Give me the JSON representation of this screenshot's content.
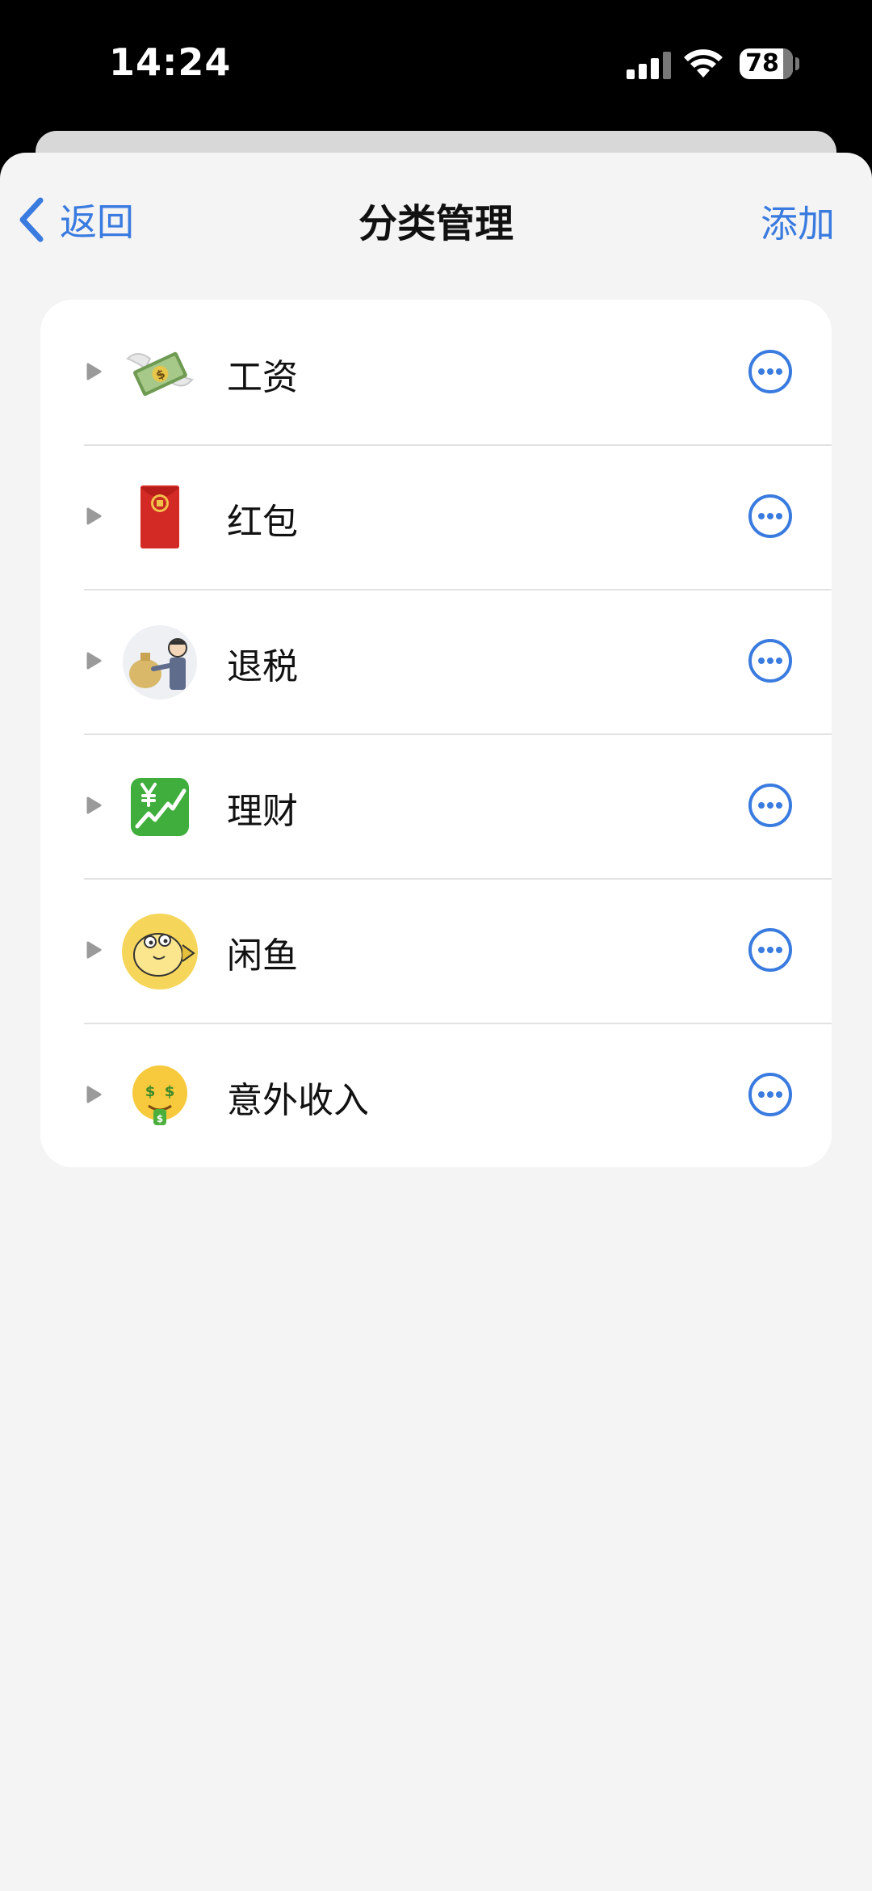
{
  "status": {
    "time": "14:24",
    "battery": "78"
  },
  "nav": {
    "back_label": "返回",
    "title": "分类管理",
    "add_label": "添加"
  },
  "categories": [
    {
      "label": "工资",
      "icon": "money-with-wings-icon"
    },
    {
      "label": "红包",
      "icon": "red-envelope-icon"
    },
    {
      "label": "退税",
      "icon": "tax-refund-icon"
    },
    {
      "label": "理财",
      "icon": "yen-chart-icon"
    },
    {
      "label": "闲鱼",
      "icon": "xianyu-fish-icon"
    },
    {
      "label": "意外收入",
      "icon": "money-mouth-face-icon"
    }
  ],
  "colors": {
    "accent": "#3a7be0",
    "background": "#f4f4f4",
    "card": "#ffffff"
  }
}
